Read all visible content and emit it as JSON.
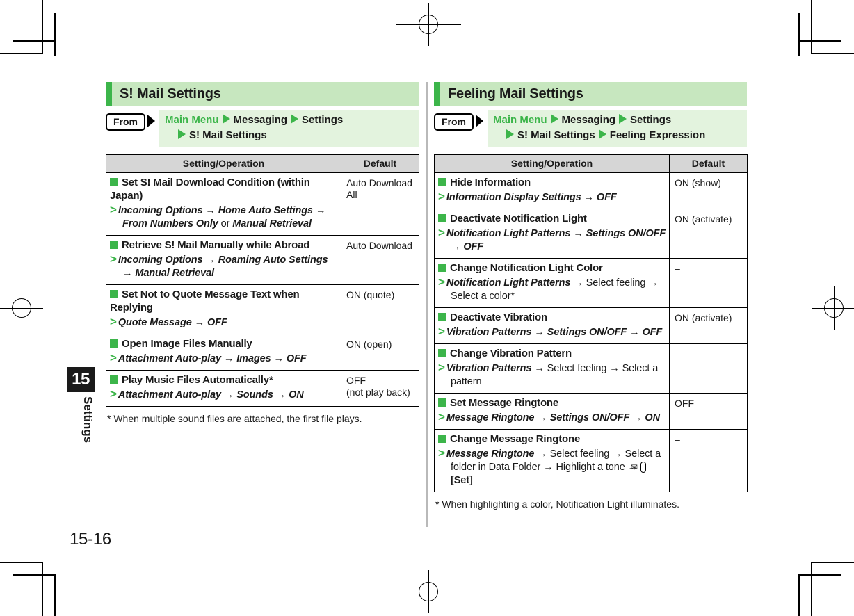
{
  "page": {
    "chapter_number": "15",
    "chapter_label": "Settings",
    "page_number": "15-16"
  },
  "columns": [
    {
      "header": {
        "title": "S! Mail Settings"
      },
      "from": {
        "tag": "From",
        "crumbs_line1": [
          "Main Menu",
          "Messaging",
          "Settings"
        ],
        "crumbs_line2": [
          "S! Mail Settings"
        ]
      },
      "table": {
        "col_operation": "Setting/Operation",
        "col_default": "Default",
        "rows": [
          {
            "title": "Set S! Mail Download Condition (within Japan)",
            "path_html": "<span class=\"bi\">Incoming Options</span> <span class=\"ar\">→</span> <span class=\"bi\">Home Auto Settings</span> <span class=\"ar\">→</span> <span class=\"bi\">From Numbers Only</span> or <span class=\"bi\">Manual Retrieval</span>",
            "default": "Auto Download All"
          },
          {
            "title": "Retrieve S! Mail Manually while Abroad",
            "path_html": "<span class=\"bi\">Incoming Options</span> <span class=\"ar\">→</span> <span class=\"bi\">Roaming Auto Settings</span> <span class=\"ar\">→</span> <span class=\"bi\">Manual Retrieval</span>",
            "default": "Auto Download"
          },
          {
            "title": "Set Not to Quote Message Text when Replying",
            "path_html": "<span class=\"bi\">Quote Message</span> <span class=\"ar\">→</span> <span class=\"bi\">OFF</span>",
            "default": "ON (quote)"
          },
          {
            "title": "Open Image Files Manually",
            "path_html": "<span class=\"bi\">Attachment Auto-play</span> <span class=\"ar\">→</span> <span class=\"bi\">Images</span> <span class=\"ar\">→</span> <span class=\"bi\">OFF</span>",
            "default": "ON (open)"
          },
          {
            "title": "Play Music Files Automatically*",
            "path_html": "<span class=\"bi\">Attachment Auto-play</span> <span class=\"ar\">→</span> <span class=\"bi\">Sounds</span> <span class=\"ar\">→</span> <span class=\"bi\">ON</span>",
            "default": "OFF\n(not play back)"
          }
        ]
      },
      "footnote": "* When multiple sound files are attached, the first file plays."
    },
    {
      "header": {
        "title": "Feeling Mail Settings"
      },
      "from": {
        "tag": "From",
        "crumbs_line1": [
          "Main Menu",
          "Messaging",
          "Settings"
        ],
        "crumbs_line2": [
          "S! Mail Settings",
          "Feeling Expression"
        ]
      },
      "table": {
        "col_operation": "Setting/Operation",
        "col_default": "Default",
        "rows": [
          {
            "title": "Hide Information",
            "path_html": "<span class=\"bi\">Information Display Settings</span> <span class=\"ar\">→</span> <span class=\"bi\">OFF</span>",
            "default": "ON (show)"
          },
          {
            "title": "Deactivate Notification Light",
            "path_html": "<span class=\"bi\">Notification Light Patterns</span> <span class=\"ar\">→</span> <span class=\"bi\">Settings ON/OFF</span> <span class=\"ar\">→</span> <span class=\"bi\">OFF</span>",
            "default": "ON (activate)"
          },
          {
            "title": "Change Notification Light Color",
            "path_html": "<span class=\"bi\">Notification Light Patterns</span> <span class=\"ar\">→</span> Select feeling <span class=\"ar\">→</span> Select a color*",
            "default": "–"
          },
          {
            "title": "Deactivate Vibration",
            "path_html": "<span class=\"bi\">Vibration Patterns</span> <span class=\"ar\">→</span> <span class=\"bi\">Settings ON/OFF</span> <span class=\"ar\">→</span> <span class=\"bi\">OFF</span>",
            "default": "ON (activate)"
          },
          {
            "title": "Change Vibration Pattern",
            "path_html": "<span class=\"bi\">Vibration Patterns</span> <span class=\"ar\">→</span> Select feeling <span class=\"ar\">→</span> Select a pattern",
            "default": "–"
          },
          {
            "title": "Set Message Ringtone",
            "path_html": "<span class=\"bi\">Message Ringtone</span> <span class=\"ar\">→</span> <span class=\"bi\">Settings ON/OFF</span> <span class=\"ar\">→</span> <span class=\"bi\">ON</span>",
            "default": "OFF"
          },
          {
            "title": "Change Message Ringtone",
            "path_html": "<span class=\"bi\">Message Ringtone</span> <span class=\"ar\">→</span> Select feeling <span class=\"ar\">→</span> Select a folder in Data Folder <span class=\"ar\">→</span> Highlight a tone <span class=\"ar\">→</span> <span class=\"env\">✉</span><span class=\"bold\">[Set]</span>",
            "default": "–"
          }
        ]
      },
      "footnote": "* When highlighting a color, Notification Light illuminates."
    }
  ],
  "colors": {
    "accent_green": "#3cb54a",
    "header_band": "#c7e7bf",
    "crumb_band": "#e3f3de",
    "table_header_gray": "#d6d6d6"
  },
  "icons": {
    "bullet": "green-square-bullet",
    "path_marker": "green-chevron-right-icon",
    "crumb_separator": "green-triangle-right-icon",
    "from_pointer": "black-triangle-right-icon",
    "mail_key": "envelope-icon"
  }
}
